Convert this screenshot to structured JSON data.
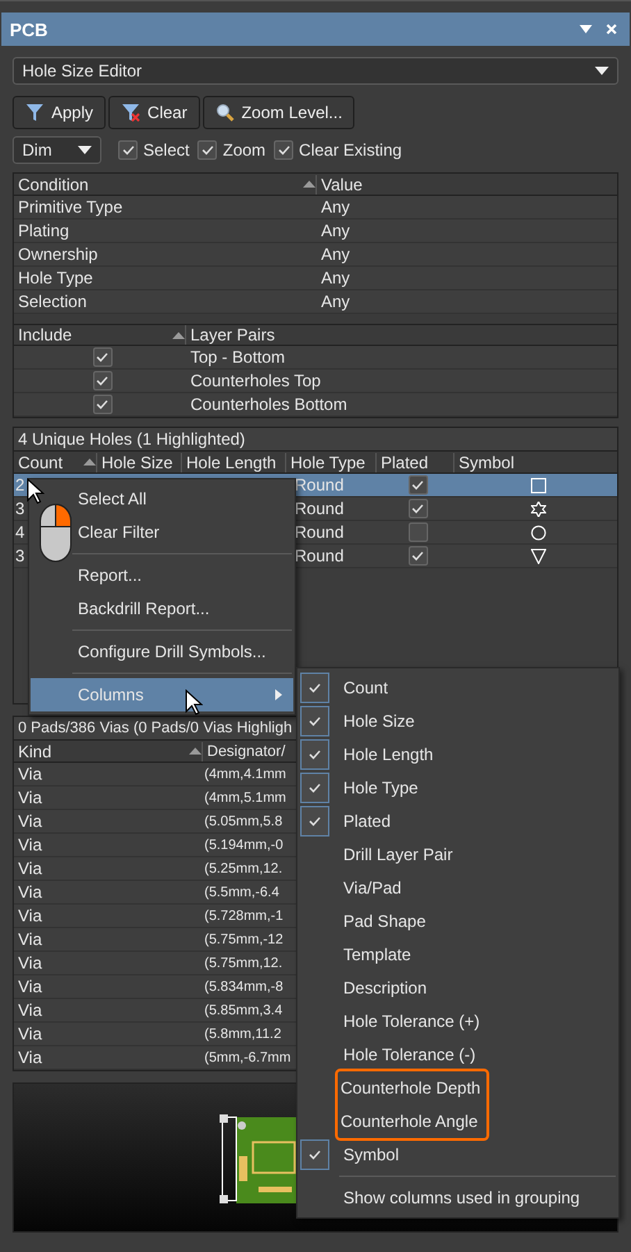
{
  "window": {
    "title": "PCB"
  },
  "mode_select": {
    "value": "Hole Size Editor"
  },
  "buttons": [
    {
      "label": "Apply"
    },
    {
      "label": "Clear"
    },
    {
      "label": "Zoom Level..."
    }
  ],
  "dim_select": {
    "value": "Dim"
  },
  "options": [
    {
      "label": "Select",
      "checked": true
    },
    {
      "label": "Zoom",
      "checked": true
    },
    {
      "label": "Clear Existing",
      "checked": true
    }
  ],
  "conditions": {
    "columns": [
      "Condition",
      "Value"
    ],
    "rows": [
      {
        "condition": "Primitive Type",
        "value": "Any"
      },
      {
        "condition": "Plating",
        "value": "Any"
      },
      {
        "condition": "Ownership",
        "value": "Any"
      },
      {
        "condition": "Hole Type",
        "value": "Any"
      },
      {
        "condition": "Selection",
        "value": "Any"
      }
    ]
  },
  "layer_pairs": {
    "columns": [
      "Include",
      "Layer Pairs"
    ],
    "rows": [
      {
        "include": true,
        "name": "Top - Bottom"
      },
      {
        "include": true,
        "name": "Counterholes Top"
      },
      {
        "include": true,
        "name": "Counterholes Bottom"
      }
    ]
  },
  "holes": {
    "title": "4 Unique Holes (1 Highlighted)",
    "columns": [
      "Count",
      "Hole Size",
      "Hole Length",
      "Hole Type",
      "Plated",
      "Symbol"
    ],
    "rows": [
      {
        "count": "2",
        "hole_type": "Round",
        "plated": true,
        "kind": "square",
        "selected": true
      },
      {
        "count": "3",
        "hole_type": "Round",
        "plated": true,
        "kind": "star",
        "selected": false
      },
      {
        "count": "4",
        "hole_type": "Round",
        "plated": false,
        "kind": "circle",
        "selected": false
      },
      {
        "count": "3",
        "hole_type": "Round",
        "plated": true,
        "kind": "triangle",
        "selected": false
      }
    ]
  },
  "context_menu": [
    {
      "kind": "item",
      "label": "Select All",
      "highlighted": false
    },
    {
      "kind": "item",
      "label": "Clear Filter",
      "highlighted": false
    },
    {
      "kind": "separator"
    },
    {
      "kind": "item",
      "label": "Report...",
      "highlighted": false
    },
    {
      "kind": "item",
      "label": "Backdrill Report...",
      "highlighted": false
    },
    {
      "kind": "separator"
    },
    {
      "kind": "item",
      "label": "Configure Drill Symbols...",
      "highlighted": false
    },
    {
      "kind": "separator"
    },
    {
      "kind": "submenu",
      "label": "Columns",
      "highlighted": true
    }
  ],
  "columns_menu": [
    {
      "kind": "item",
      "label": "Count",
      "checked": true,
      "outlined": false
    },
    {
      "kind": "item",
      "label": "Hole Size",
      "checked": true,
      "outlined": false
    },
    {
      "kind": "item",
      "label": "Hole Length",
      "checked": true,
      "outlined": false
    },
    {
      "kind": "item",
      "label": "Hole Type",
      "checked": true,
      "outlined": false
    },
    {
      "kind": "item",
      "label": "Plated",
      "checked": true,
      "outlined": false
    },
    {
      "kind": "item",
      "label": "Drill Layer Pair",
      "checked": false,
      "outlined": false
    },
    {
      "kind": "item",
      "label": "Via/Pad",
      "checked": false,
      "outlined": false
    },
    {
      "kind": "item",
      "label": "Pad Shape",
      "checked": false,
      "outlined": false
    },
    {
      "kind": "item",
      "label": "Template",
      "checked": false,
      "outlined": false
    },
    {
      "kind": "item",
      "label": "Description",
      "checked": false,
      "outlined": false
    },
    {
      "kind": "item",
      "label": "Hole Tolerance (+)",
      "checked": false,
      "outlined": false
    },
    {
      "kind": "item",
      "label": "Hole Tolerance (-)",
      "checked": false,
      "outlined": false
    },
    {
      "kind": "item",
      "label": "Counterhole Depth",
      "checked": false,
      "outlined": true
    },
    {
      "kind": "item",
      "label": "Counterhole Angle",
      "checked": false,
      "outlined": true
    },
    {
      "kind": "item",
      "label": "Symbol",
      "checked": true,
      "outlined": false
    },
    {
      "kind": "separator"
    },
    {
      "kind": "item",
      "label": "Show columns used in grouping",
      "checked": false,
      "outlined": false
    }
  ],
  "vias": {
    "title": "0 Pads/386 Vias (0 Pads/0 Vias Highligh",
    "columns": [
      "Kind",
      "Designator/"
    ],
    "rows": [
      {
        "kind": "Via",
        "designator": "(4mm,4.1mm"
      },
      {
        "kind": "Via",
        "designator": "(4mm,5.1mm"
      },
      {
        "kind": "Via",
        "designator": "(5.05mm,5.8"
      },
      {
        "kind": "Via",
        "designator": "(5.194mm,-0"
      },
      {
        "kind": "Via",
        "designator": "(5.25mm,12."
      },
      {
        "kind": "Via",
        "designator": "(5.5mm,-6.4"
      },
      {
        "kind": "Via",
        "designator": "(5.728mm,-1"
      },
      {
        "kind": "Via",
        "designator": "(5.75mm,-12"
      },
      {
        "kind": "Via",
        "designator": "(5.75mm,12."
      },
      {
        "kind": "Via",
        "designator": "(5.834mm,-8"
      },
      {
        "kind": "Via",
        "designator": "(5.85mm,3.4"
      },
      {
        "kind": "Via",
        "designator": "(5.8mm,11.2"
      },
      {
        "kind": "Via",
        "designator": "(5mm,-6.7mm"
      }
    ]
  }
}
